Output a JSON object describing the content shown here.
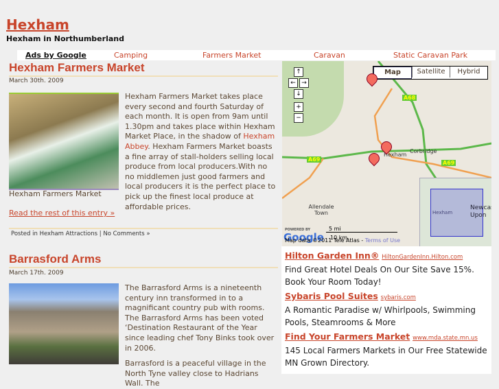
{
  "site": {
    "title": "Hexham",
    "tagline": "Hexham in Northumberland"
  },
  "adbar": {
    "label": "Ads by Google",
    "links": [
      "Camping",
      "Farmers Market",
      "Caravan",
      "Static Caravan Park"
    ]
  },
  "posts": [
    {
      "title": "Hexham Farmers Market",
      "date": "March 30th. 2009",
      "image_caption": "Hexham Farmers Market",
      "text_before": "Hexham Farmers Market takes place every second and fourth Saturday of each month. It is open from 9am until 1.30pm and takes place within Hexham Market Place, in the shadow of ",
      "link": "Hexham Abbey",
      "text_after": ". Hexham Farmers Market boasts a fine array of stall-holders selling local produce from local producers.With no no middlemen  just good farmers and local producers it is the perfect place to pick up the finest local produce at affordable prices.",
      "read_more": "Read the rest of this entry »",
      "posted_in": "Posted in",
      "category": "Hexham Attractions",
      "sep": "|",
      "comments": "No Comments »"
    },
    {
      "title": "Barrasford Arms",
      "date": "March 17th. 2009",
      "para1": "The Barrasford Arms is a nineteenth century inn transformed in to a magnificant country pub with rooms. The Barrasford Arms has been voted ‘Destination Restaurant of the Year  since leading chef Tony Binks took over in 2006.",
      "para2": "Barrasford  is a peaceful village in the North Tyne valley close to Hadrians Wall. The"
    }
  ],
  "map": {
    "types": [
      "Map",
      "Satellite",
      "Hybrid"
    ],
    "roads": [
      "A68",
      "A69",
      "A69"
    ],
    "places": [
      "Hexham",
      "Corbridge",
      "Allendale Town",
      "Newcastle Upon"
    ],
    "scale_mi": "5 mi",
    "scale_km": "10 km",
    "powered": "POWERED BY",
    "google": "Google",
    "attribution": "Map data ©2011 Tele Atlas - ",
    "terms": "Terms of Use",
    "controls": [
      "↑",
      "←",
      "→",
      "↓",
      "+",
      "−"
    ]
  },
  "ads": [
    {
      "title": "Hilton Garden Inn®",
      "url": "HiltonGardenInn.Hilton.com",
      "desc": "Find Great Hotel Deals On Our Site Save 15%. Book Your Room Today!"
    },
    {
      "title": "Sybaris Pool Suites",
      "url": "sybaris.com",
      "desc": "A Romantic Paradise w/ Whirlpools, Swimming Pools, Steamrooms & More"
    },
    {
      "title": "Find Your Farmers Market",
      "url": "www.mda.state.mn.us",
      "desc": "145 Local Farmers Markets in Our Free Statewide MN Grown Directory."
    }
  ]
}
